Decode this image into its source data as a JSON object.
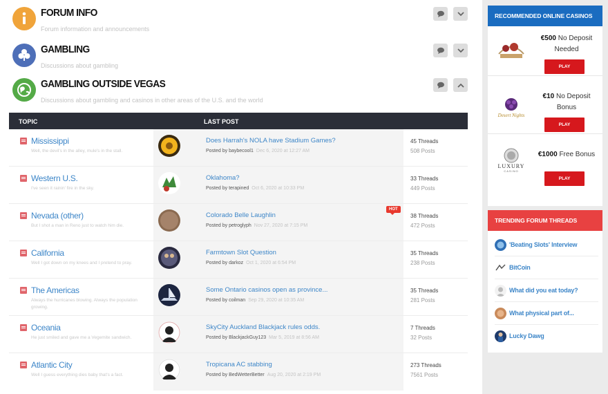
{
  "categories": [
    {
      "title": "FORUM INFO",
      "desc": "Forum information and announcements",
      "icon": "info-icon",
      "color": "#f0a43a"
    },
    {
      "title": "GAMBLING",
      "desc": "Discussions about gambling",
      "icon": "club-icon",
      "color": "#4e6fb8"
    },
    {
      "title": "GAMBLING OUTSIDE VEGAS",
      "desc": "Discussions about gambling and casinos in other areas of the U.S. and the world",
      "icon": "globe-icon",
      "color": "#54aa47"
    }
  ],
  "table": {
    "col_topic": "TOPIC",
    "col_last_post": "LAST POST"
  },
  "rows": [
    {
      "name": "Mississippi",
      "desc": "Well, the devil's in the alley, mule's in the stall.",
      "post": "Does Harrah's NOLA have Stadium Games?",
      "by": "Posted by baybecool1",
      "date": "Dec 6, 2020 at 12:27 AM",
      "threads": "45 Threads",
      "posts": "508 Posts",
      "hot": ""
    },
    {
      "name": "Western U.S.",
      "desc": "I've seen it rainin' fire in the sky.",
      "post": "Oklahoma?",
      "by": "Posted by terapined",
      "date": "Oct 6, 2020 at 10:33 PM",
      "threads": "33 Threads",
      "posts": "449 Posts",
      "hot": ""
    },
    {
      "name": "Nevada (other)",
      "desc": "But I shot a man in Reno just to watch him die.",
      "post": "Colorado Belle Laughlin",
      "by": "Posted by petroglyph",
      "date": "Nov 27, 2020 at 7:15 PM",
      "threads": "38 Threads",
      "posts": "472 Posts",
      "hot": "HOT"
    },
    {
      "name": "California",
      "desc": "Well I got down on my knees and I pretend to pray.",
      "post": "Farmtown Slot Question",
      "by": "Posted by darkoz",
      "date": "Oct 1, 2020 at 6:54 PM",
      "threads": "35 Threads",
      "posts": "238 Posts",
      "hot": ""
    },
    {
      "name": "The Americas",
      "desc": "Always the hurricanes blowing. Always the population growing.",
      "post": "Some Ontario casinos open as province...",
      "by": "Posted by coilman",
      "date": "Sep 29, 2020 at 10:35 AM",
      "threads": "35 Threads",
      "posts": "281 Posts",
      "hot": ""
    },
    {
      "name": "Oceania",
      "desc": "He just smiled and gave me a Vegemite sandwich.",
      "post": "SkyCity Auckland Blackjack rules odds.",
      "by": "Posted by BlackjackGuy123",
      "date": "Mar 5, 2019 at 8:56 AM",
      "threads": "7 Threads",
      "posts": "32 Posts",
      "hot": ""
    },
    {
      "name": "Atlantic City",
      "desc": "Well I guess everything dies baby that's a fact.",
      "post": "Tropicana AC stabbing",
      "by": "Posted by BedWetterBetter",
      "date": "Aug 20, 2020 at 2:19 PM",
      "threads": "273 Threads",
      "posts": "7561 Posts",
      "hot": ""
    }
  ],
  "sidebar": {
    "casinos_title": "RECOMMENDED ONLINE CASINOS",
    "casinos_color": "#1a6cc0",
    "casinos": [
      {
        "bonus_amount": "€500",
        "bonus_text": "No Deposit Needed",
        "play": "PLAY",
        "logo": "casino-logo-1"
      },
      {
        "bonus_amount": "€10",
        "bonus_text": "No Deposit Bonus",
        "play": "PLAY",
        "logo": "casino-logo-2",
        "logo_text": "Desert Nights"
      },
      {
        "bonus_amount": "€1000",
        "bonus_text": "Free Bonus",
        "play": "PLAY",
        "logo": "casino-logo-3",
        "logo_text": "LUXURY",
        "logo_sub": "CASINO"
      }
    ],
    "trending_title": "TRENDING FORUM THREADS",
    "trending_color": "#e84141",
    "trending": [
      "'Beating Slots' Interview",
      "BitCoin",
      "What did you eat today?",
      "What physical part of...",
      "Lucky Dawg"
    ]
  }
}
